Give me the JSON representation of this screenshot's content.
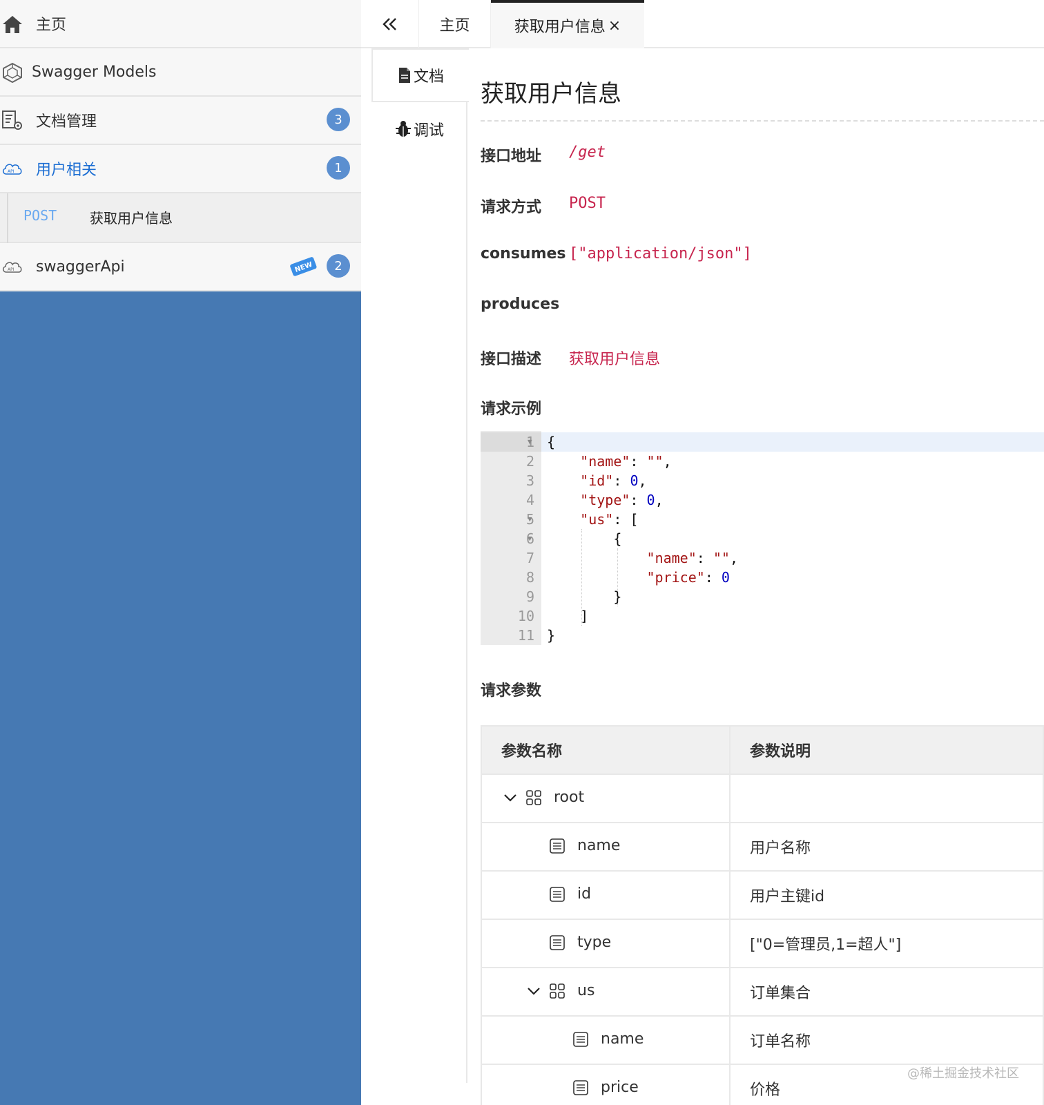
{
  "sidebar": {
    "items": [
      {
        "label": "主页",
        "icon": "home-icon"
      },
      {
        "label": "Swagger Models",
        "icon": "models-icon"
      },
      {
        "label": "文档管理",
        "icon": "doc-settings-icon",
        "badge": "3"
      },
      {
        "label": "用户相关",
        "icon": "api-cloud-icon",
        "badge": "1",
        "active": true
      },
      {
        "label": "swaggerApi",
        "icon": "api-cloud-icon",
        "badge": "2",
        "tag": "NEW"
      }
    ],
    "sub_item": {
      "method": "POST",
      "label": "获取用户信息"
    }
  },
  "tabs": {
    "home": "主页",
    "active": "获取用户信息",
    "close": "×"
  },
  "vtabs": {
    "doc": "文档",
    "debug": "调试"
  },
  "doc": {
    "title": "获取用户信息",
    "fields": {
      "address_label": "接口地址",
      "address_value": "/get",
      "method_label": "请求方式",
      "method_value": "POST",
      "consumes_label": "consumes",
      "consumes_value": "[\"application/json\"]",
      "produces_label": "produces",
      "desc_label": "接口描述",
      "desc_value": "获取用户信息"
    },
    "example_title": "请求示例",
    "params_title": "请求参数"
  },
  "code_lines": [
    {
      "n": "1",
      "fold": true
    },
    {
      "n": "2"
    },
    {
      "n": "3"
    },
    {
      "n": "4"
    },
    {
      "n": "5",
      "fold": true
    },
    {
      "n": "6",
      "fold": true
    },
    {
      "n": "7"
    },
    {
      "n": "8"
    },
    {
      "n": "9"
    },
    {
      "n": "10"
    },
    {
      "n": "11"
    }
  ],
  "code_text": {
    "l1": "{",
    "l2_key": "\"name\"",
    "l2_val": "\"\"",
    "l3_key": "\"id\"",
    "l3_val": "0",
    "l4_key": "\"type\"",
    "l4_val": "0",
    "l5_key": "\"us\"",
    "l5_tail": "[",
    "l6": "{",
    "l7_key": "\"name\"",
    "l7_val": "\"\"",
    "l8_key": "\"price\"",
    "l8_val": "0",
    "l9": "}",
    "l10": "]",
    "l11": "}"
  },
  "params": {
    "headers": [
      "参数名称",
      "参数说明"
    ],
    "rows": [
      {
        "name": "root",
        "desc": "",
        "type": "object",
        "expanded": true
      },
      {
        "name": "name",
        "desc": "用户名称",
        "type": "field"
      },
      {
        "name": "id",
        "desc": "用户主键id",
        "type": "field"
      },
      {
        "name": "type",
        "desc": "[\"0=管理员,1=超人\"]",
        "type": "field"
      },
      {
        "name": "us",
        "desc": "订单集合",
        "type": "object",
        "expanded": true
      },
      {
        "name": "name",
        "desc": "订单名称",
        "type": "field"
      },
      {
        "name": "price",
        "desc": "价格",
        "type": "field"
      }
    ]
  },
  "watermark": "@稀土掘金技术社区",
  "colors": {
    "sidebar_bg": "#4679b3",
    "badge": "#5b8fd0",
    "active_link": "#1e6fd3",
    "value_red": "#c7254e",
    "post_method": "#6aa9f0"
  }
}
